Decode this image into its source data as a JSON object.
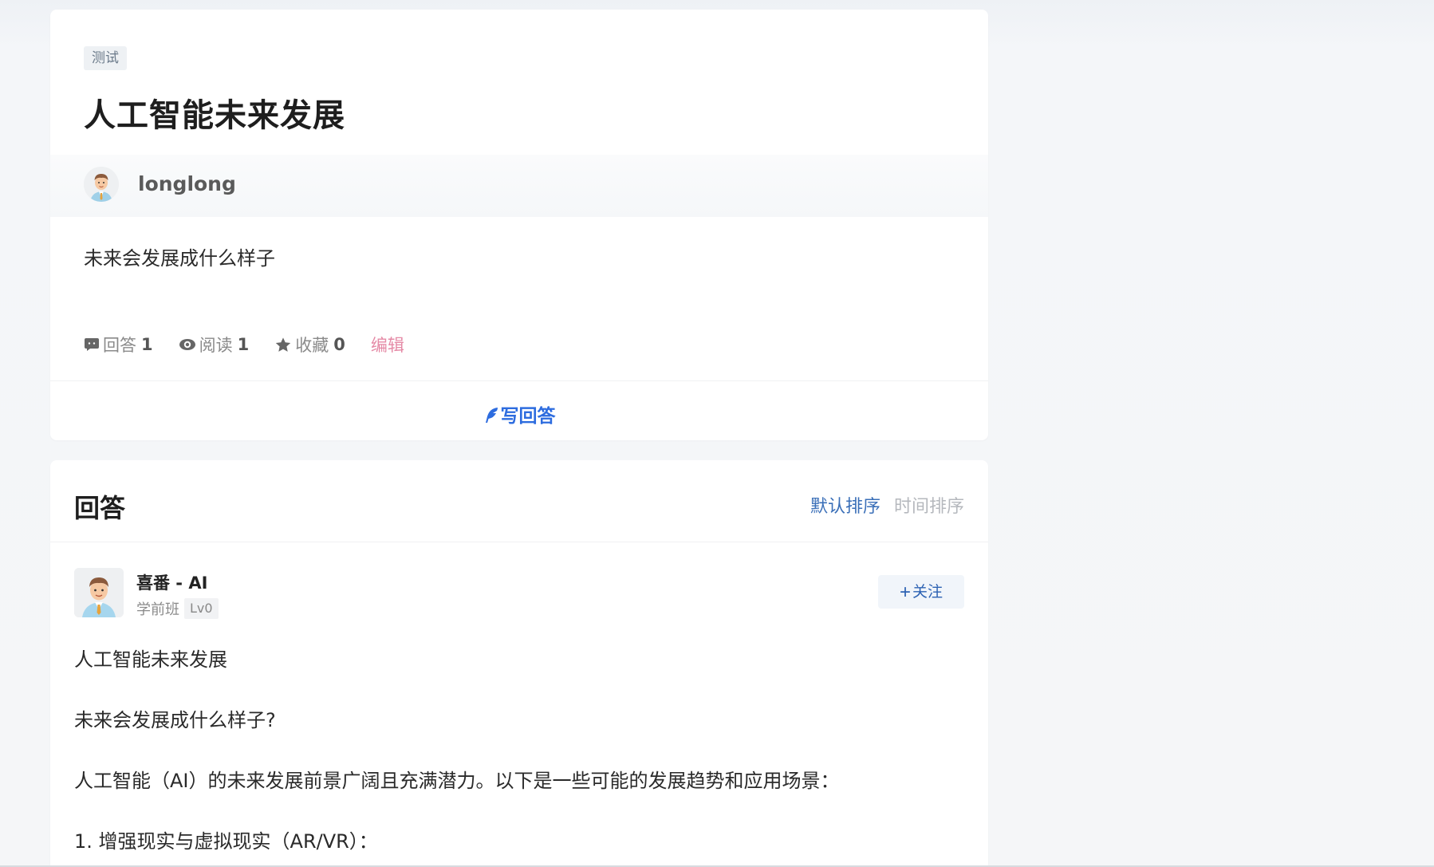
{
  "question": {
    "tag": "测试",
    "title": "人工智能未来发展",
    "author": "longlong",
    "description": "未来会发展成什么样子",
    "stats": {
      "answers_label": "回答",
      "answers_count": "1",
      "reads_label": "阅读",
      "reads_count": "1",
      "favorites_label": "收藏",
      "favorites_count": "0"
    },
    "edit_label": "编辑",
    "write_answer_label": "写回答"
  },
  "answers": {
    "header_title": "回答",
    "sort_default": "默认排序",
    "sort_time": "时间排序",
    "items": [
      {
        "name": "喜番 - AI",
        "grade": "学前班",
        "level": "Lv0",
        "follow_label": "关注",
        "content": [
          "人工智能未来发展",
          "未来会发展成什么样子?",
          "人工智能（AI）的未来发展前景广阔且充满潜力。以下是一些可能的发展趋势和应用场景：",
          "1. 增强现实与虚拟现实（AR/VR）："
        ]
      }
    ]
  },
  "colors": {
    "accent_blue": "#2d6cdf",
    "edit_pink": "#e58aa6",
    "sort_active": "#3a6fb8",
    "sort_inactive": "#b5b8bd"
  },
  "icons": {
    "answers": "comment-icon",
    "reads": "eye-icon",
    "favorites": "star-icon",
    "write": "feather-icon",
    "follow": "plus-icon"
  }
}
